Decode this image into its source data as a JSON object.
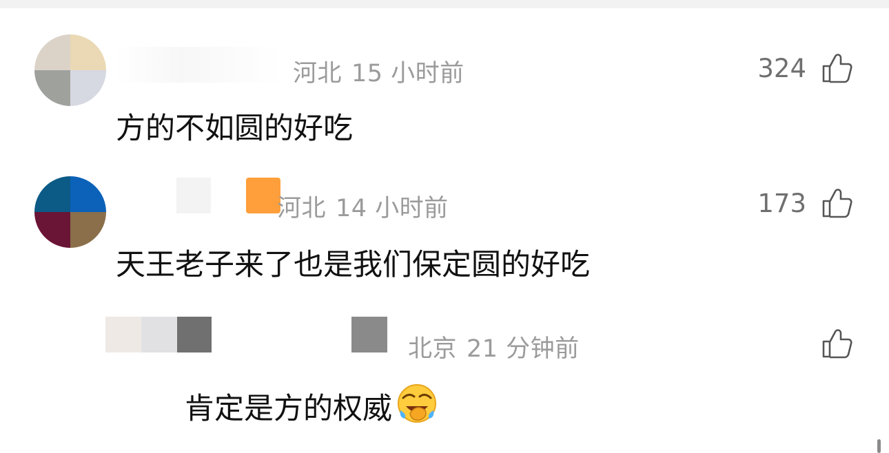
{
  "comments": [
    {
      "location": "河北",
      "time": "15 小时前",
      "text": "方的不如圆的好吃",
      "likes": "324"
    },
    {
      "location": "河北",
      "time": "14 小时前",
      "text": "天王老子来了也是我们保定圆的好吃",
      "likes": "173"
    },
    {
      "location": "北京",
      "time": "21 分钟前",
      "text": "肯定是方的权威",
      "likes": "",
      "emoji": "face-with-tears-of-joy-icon"
    }
  ],
  "colors": {
    "meta_gray": "#9b9b9b",
    "text_black": "#111111",
    "like_gray": "#6f6f6f",
    "accent_orange": "#ff9f3b"
  },
  "icons": {
    "like": "thumbs-up-outline-icon"
  }
}
